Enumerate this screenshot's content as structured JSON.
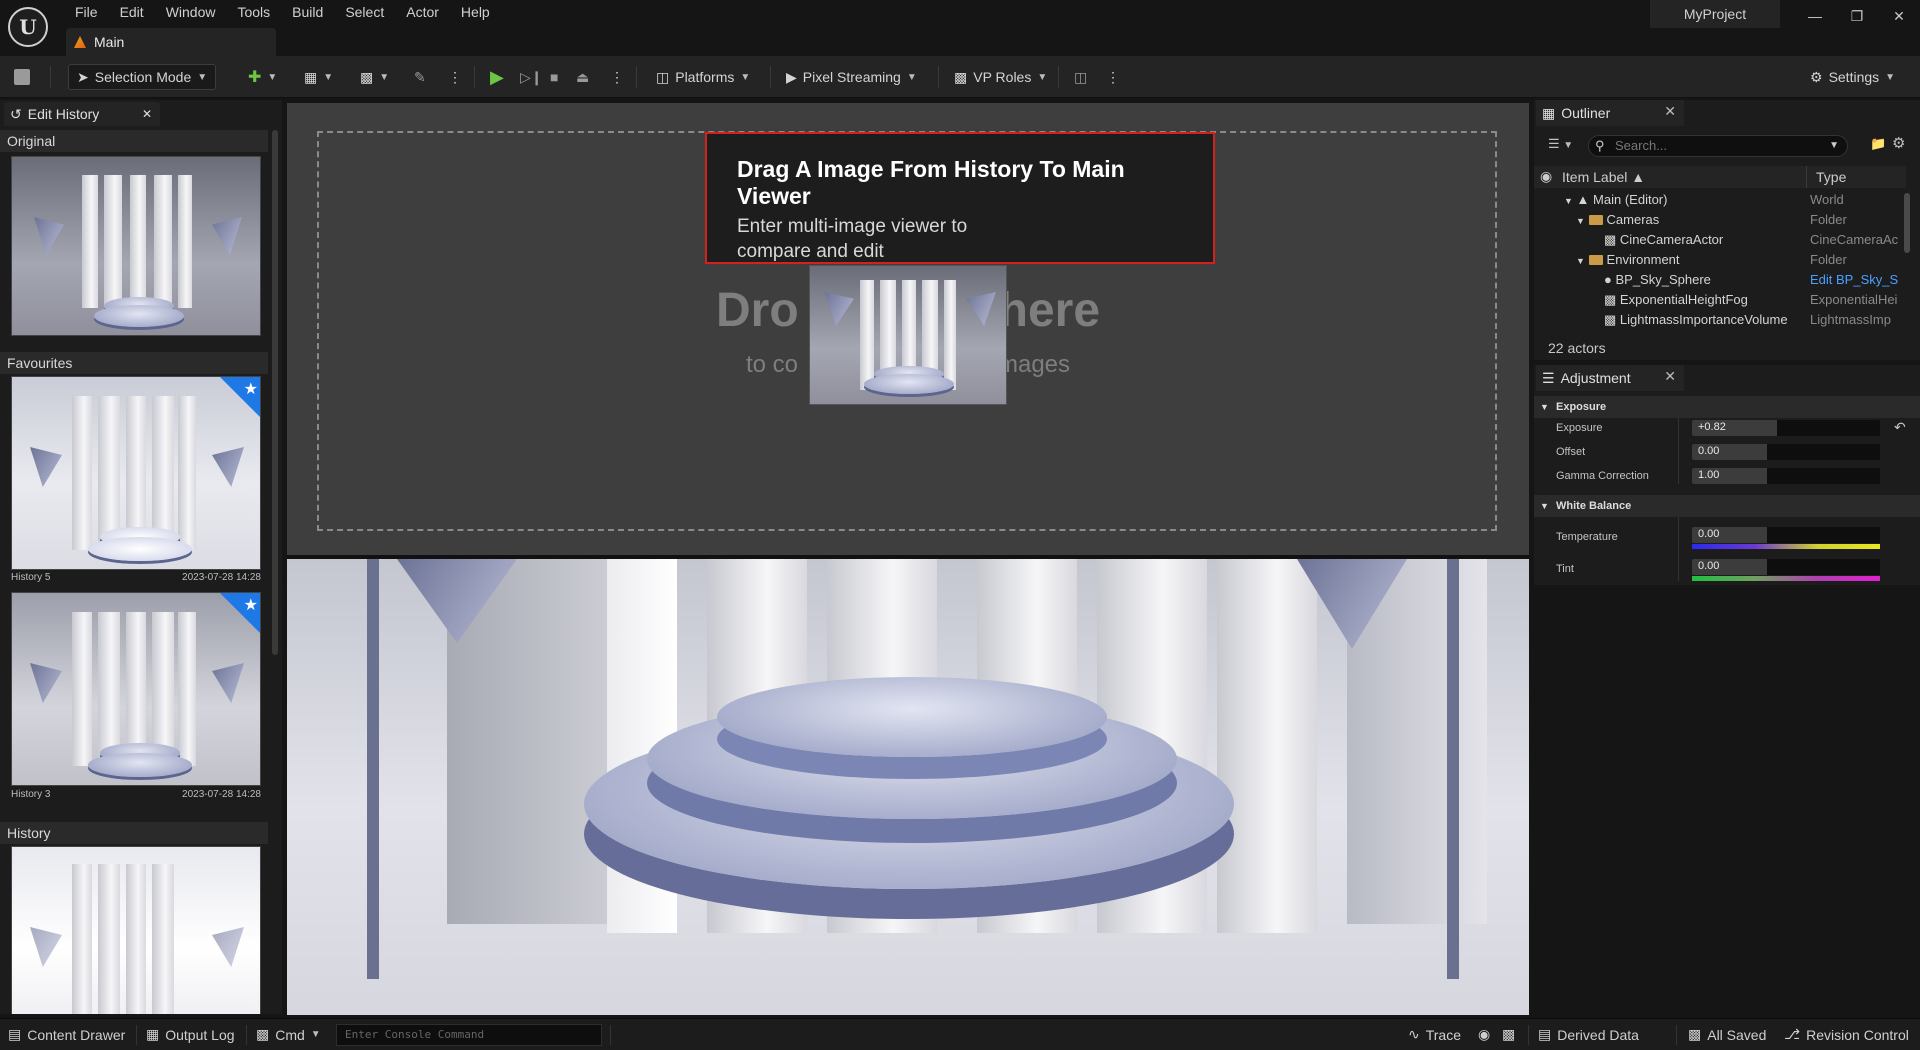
{
  "window": {
    "menu": [
      "File",
      "Edit",
      "Window",
      "Tools",
      "Build",
      "Select",
      "Actor",
      "Help"
    ],
    "doc_tab": "Main",
    "project_name": "MyProject"
  },
  "toolbar": {
    "selection_mode": "Selection Mode",
    "platforms": "Platforms",
    "pixel_streaming": "Pixel Streaming",
    "vp_roles": "VP Roles",
    "settings": "Settings"
  },
  "edit_history": {
    "tab_label": "Edit History",
    "original_header": "Original",
    "favourites_header": "Favourites",
    "history_header": "History",
    "favourites": [
      {
        "name": "History 5",
        "date": "2023-07-28 14:28"
      },
      {
        "name": "History 3",
        "date": "2023-07-28 14:28"
      }
    ]
  },
  "viewer": {
    "drop_title_left": "Dro",
    "drop_title_right": "here",
    "drop_sub_left": "to co",
    "drop_sub_right": "mages",
    "tooltip_title": "Drag A Image From History To Main Viewer",
    "tooltip_body": "Enter multi-image viewer to compare and edit"
  },
  "outliner": {
    "tab_label": "Outliner",
    "search_placeholder": "Search...",
    "col_label": "Item Label",
    "col_type": "Type",
    "rows": [
      {
        "label": "Main (Editor)",
        "type": "World"
      },
      {
        "label": "Cameras",
        "type": "Folder"
      },
      {
        "label": "CineCameraActor",
        "type": "CineCameraAc"
      },
      {
        "label": "Environment",
        "type": "Folder"
      },
      {
        "label": "BP_Sky_Sphere",
        "type": "Edit BP_Sky_S"
      },
      {
        "label": "ExponentialHeightFog",
        "type": "ExponentialHei"
      },
      {
        "label": "LightmassImportanceVolume",
        "type": "LightmassImp"
      }
    ],
    "actor_count": "22 actors"
  },
  "adjustment": {
    "tab_label": "Adjustment",
    "exposure_group": "Exposure",
    "white_balance_group": "White Balance",
    "props": {
      "exposure": {
        "label": "Exposure",
        "value": "+0.82"
      },
      "offset": {
        "label": "Offset",
        "value": "0.00"
      },
      "gamma": {
        "label": "Gamma Correction",
        "value": "1.00"
      },
      "temperature": {
        "label": "Temperature",
        "value": "0.00"
      },
      "tint": {
        "label": "Tint",
        "value": "0.00"
      }
    }
  },
  "statusbar": {
    "content_drawer": "Content Drawer",
    "output_log": "Output Log",
    "cmd": "Cmd",
    "console_placeholder": "Enter Console Command",
    "trace": "Trace",
    "derived_data": "Derived Data",
    "all_saved": "All Saved",
    "revision_control": "Revision Control"
  },
  "colors": {
    "accent_red": "#d32020",
    "favourite_blue": "#1e78e6",
    "play_green": "#6cc644",
    "link_blue": "#4aa0ff"
  },
  "icons": [
    "ue-logo-icon",
    "save-icon",
    "play-icon",
    "step-icon",
    "stop-icon",
    "eject-icon",
    "settings-gear-icon",
    "history-icon",
    "eye-icon",
    "filter-icon",
    "search-icon",
    "folder-icon",
    "camera-icon",
    "sphere-icon",
    "close-icon",
    "reset-arrow-icon",
    "star-icon"
  ]
}
